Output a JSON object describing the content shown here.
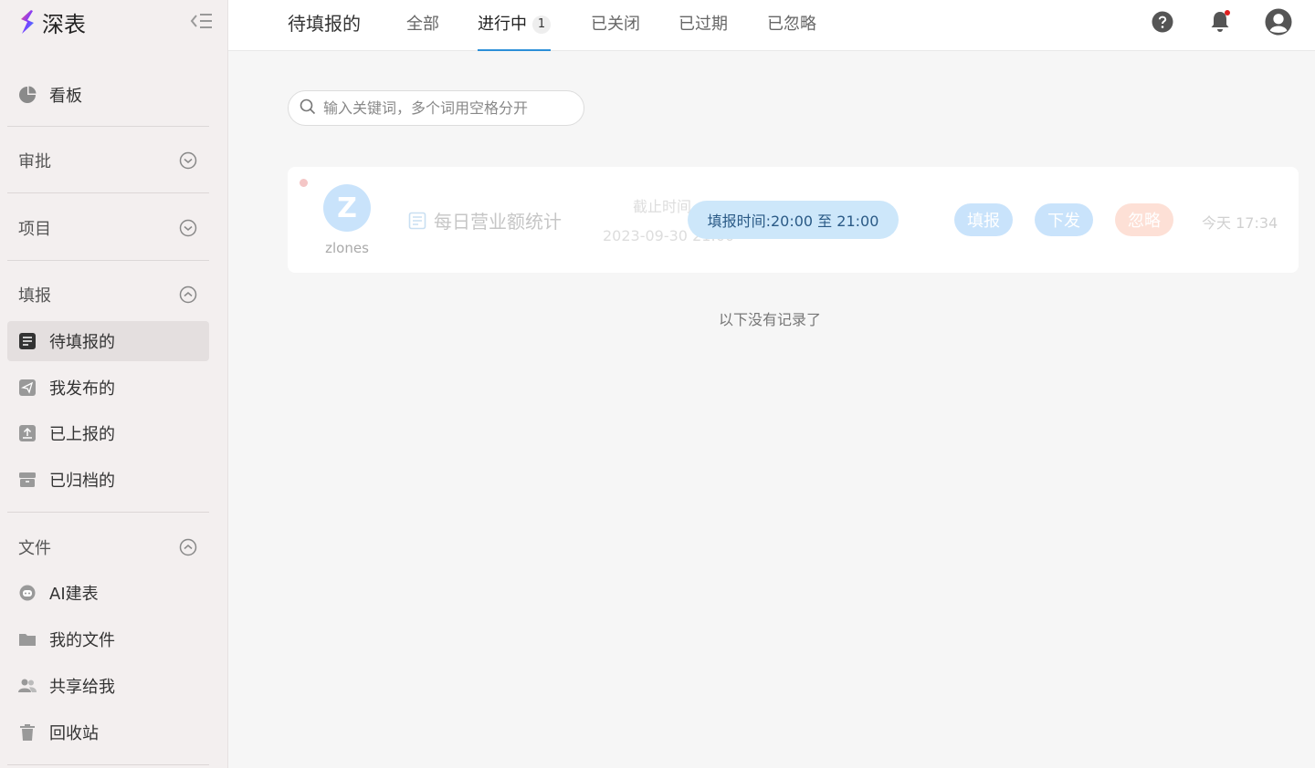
{
  "app": {
    "logo_text": "深表",
    "colors": {
      "accent": "#2b8fd8",
      "brand_gradient": [
        "#ff4d7d",
        "#7b3cff",
        "#2f9bff"
      ],
      "notification_dot": "#e02020"
    }
  },
  "sidebar": {
    "dashboard": {
      "label": "看板",
      "icon": "pie-chart-icon"
    },
    "groups": {
      "approval": {
        "label": "审批",
        "expanded": false
      },
      "project": {
        "label": "项目",
        "expanded": false
      },
      "report": {
        "label": "填报",
        "expanded": true
      },
      "files": {
        "label": "文件",
        "expanded": true
      }
    },
    "report_items": [
      {
        "label": "待填报的",
        "icon": "document-icon",
        "active": true
      },
      {
        "label": "我发布的",
        "icon": "send-icon"
      },
      {
        "label": "已上报的",
        "icon": "upload-icon"
      },
      {
        "label": "已归档的",
        "icon": "archive-icon"
      }
    ],
    "file_items": [
      {
        "label": "AI建表",
        "icon": "robot-icon"
      },
      {
        "label": "我的文件",
        "icon": "folder-icon"
      },
      {
        "label": "共享给我",
        "icon": "users-icon"
      },
      {
        "label": "回收站",
        "icon": "trash-icon"
      }
    ]
  },
  "header": {
    "title": "待填报的",
    "tabs": [
      {
        "label": "全部"
      },
      {
        "label": "进行中",
        "badge": "1",
        "active": true
      },
      {
        "label": "已关闭"
      },
      {
        "label": "已过期"
      },
      {
        "label": "已忽略"
      }
    ]
  },
  "search": {
    "placeholder": "输入关键词，多个词用空格分开",
    "value": ""
  },
  "tasks": [
    {
      "avatar_letter": "Z",
      "user": "zlones",
      "title": "每日营业额统计",
      "deadline_label": "截止时间",
      "deadline": "2023-09-30 21:00",
      "tooltip": "填报时间:20:00 至 21:00",
      "actions": {
        "fill": "填报",
        "issue": "下发",
        "ignore": "忽略"
      },
      "time": "今天 17:34"
    }
  ],
  "list_end_text": "以下没有记录了"
}
